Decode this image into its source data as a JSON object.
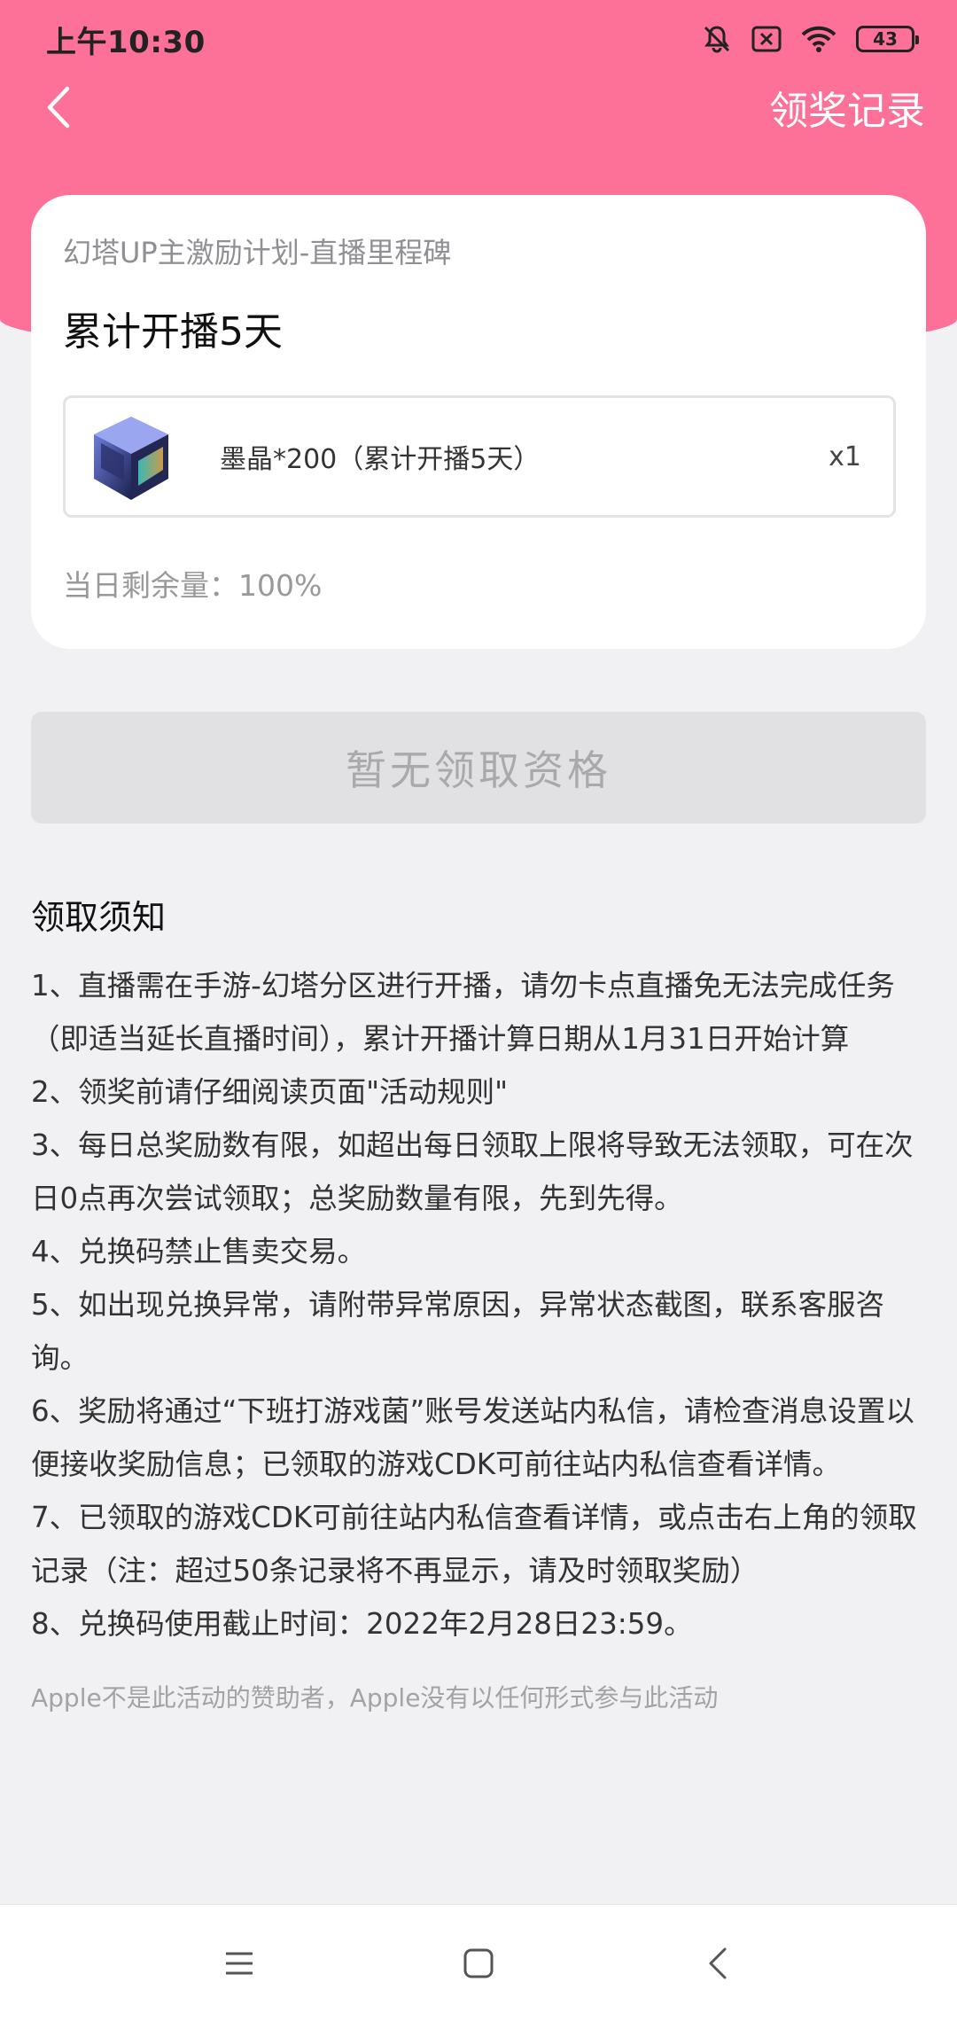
{
  "status_bar": {
    "time": "上午10:30",
    "battery": "43",
    "icons": [
      "bell-off-icon",
      "sim-x-icon",
      "wifi-icon",
      "battery-icon"
    ]
  },
  "nav": {
    "back_icon": "chevron-left-icon",
    "records_label": "领奖记录",
    "accent_color": "#fd7199"
  },
  "card": {
    "subtitle": "幻塔UP主激励计划-直播里程碑",
    "title": "累计开播5天",
    "reward": {
      "icon": "crystal-cube-icon",
      "name": "墨晶*200（累计开播5天）",
      "quantity": "x1"
    },
    "remaining": "当日剩余量：100%"
  },
  "claim_button": {
    "label": "暂无领取资格"
  },
  "notice": {
    "title": "领取须知",
    "items": [
      "1、直播需在手游-幻塔分区进行开播，请勿卡点直播免无法完成任务（即适当延长直播时间），累计开播计算日期从1月31日开始计算",
      "2、领奖前请仔细阅读页面\"活动规则\"",
      "3、每日总奖励数有限，如超出每日领取上限将导致无法领取，可在次日0点再次尝试领取；总奖励数量有限，先到先得。",
      "4、兑换码禁止售卖交易。",
      "5、如出现兑换异常，请附带异常原因，异常状态截图，联系客服咨询。",
      "6、奖励将通过“下班打游戏菌”账号发送站内私信，请检查消息设置以便接收奖励信息；已领取的游戏CDK可前往站内私信查看详情。",
      "7、已领取的游戏CDK可前往站内私信查看详情，或点击右上角的领取记录（注：超过50条记录将不再显示，请及时领取奖励）",
      "8、兑换码使用截止时间：2022年2月28日23:59。"
    ]
  },
  "disclaimer": "Apple不是此活动的赞助者，Apple没有以任何形式参与此活动",
  "bottom_nav": {
    "icons": [
      "menu-icon",
      "home-square-icon",
      "back-triangle-icon"
    ]
  }
}
